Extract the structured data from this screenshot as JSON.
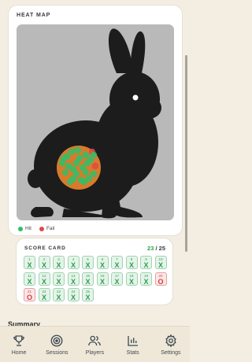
{
  "heat_map": {
    "title": "HEAT MAP",
    "legend": [
      {
        "label": "Hit",
        "color": "#2fbf6a"
      },
      {
        "label": "Fail",
        "color": "#e04848"
      }
    ]
  },
  "score_card": {
    "title": "SCORE CARD",
    "hits": "23",
    "separator": "/",
    "total": "25",
    "shots": [
      {
        "n": "1",
        "r": "X"
      },
      {
        "n": "2",
        "r": "X"
      },
      {
        "n": "3",
        "r": "X"
      },
      {
        "n": "4",
        "r": "X"
      },
      {
        "n": "5",
        "r": "X"
      },
      {
        "n": "6",
        "r": "X"
      },
      {
        "n": "7",
        "r": "X"
      },
      {
        "n": "8",
        "r": "X"
      },
      {
        "n": "9",
        "r": "X"
      },
      {
        "n": "10",
        "r": "X"
      },
      {
        "n": "11",
        "r": "X"
      },
      {
        "n": "12",
        "r": "X"
      },
      {
        "n": "13",
        "r": "X"
      },
      {
        "n": "14",
        "r": "X"
      },
      {
        "n": "15",
        "r": "X"
      },
      {
        "n": "16",
        "r": "X"
      },
      {
        "n": "17",
        "r": "X"
      },
      {
        "n": "18",
        "r": "X"
      },
      {
        "n": "19",
        "r": "X"
      },
      {
        "n": "20",
        "r": "O"
      },
      {
        "n": "21",
        "r": "O"
      },
      {
        "n": "22",
        "r": "X"
      },
      {
        "n": "23",
        "r": "X"
      },
      {
        "n": "24",
        "r": "X"
      },
      {
        "n": "25",
        "r": "X"
      }
    ]
  },
  "summary": {
    "title": "Summary"
  },
  "tabs": [
    {
      "label": "Home",
      "icon": "trophy-icon"
    },
    {
      "label": "Sessions",
      "icon": "target-icon"
    },
    {
      "label": "Players",
      "icon": "users-icon"
    },
    {
      "label": "Stats",
      "icon": "bar-chart-icon"
    },
    {
      "label": "Settings",
      "icon": "gear-icon"
    }
  ],
  "colors": {
    "background": "#f4eee2",
    "hit": "#2fbf6a",
    "fail": "#e04848",
    "kill_zone": "#d97a2b",
    "silhouette": "#1c1c1c"
  }
}
